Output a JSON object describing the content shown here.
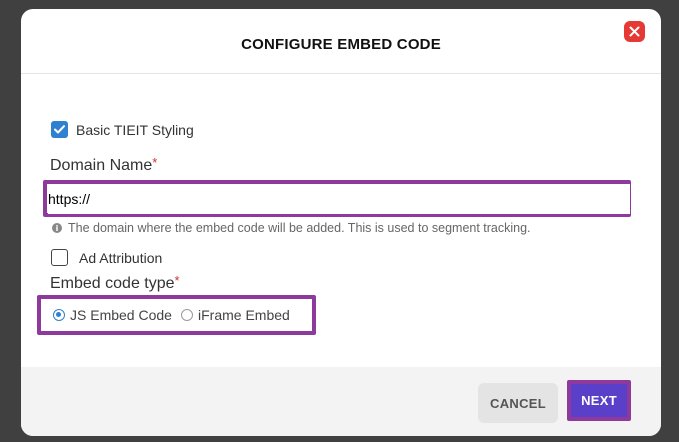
{
  "modal": {
    "title": "CONFIGURE EMBED CODE",
    "close_icon": "close-icon"
  },
  "form": {
    "basic_styling": {
      "label": "Basic TIEIT Styling",
      "checked": true
    },
    "domain": {
      "label": "Domain Name",
      "required_mark": "*",
      "value": "https://",
      "hint": "The domain where the embed code will be added. This is used to segment tracking."
    },
    "ad_attribution": {
      "label": "Ad Attribution",
      "checked": false
    },
    "embed_type": {
      "label": "Embed code type",
      "required_mark": "*",
      "options": [
        {
          "label": "JS Embed Code",
          "selected": true
        },
        {
          "label": "iFrame Embed",
          "selected": false
        }
      ]
    }
  },
  "footer": {
    "cancel_label": "CANCEL",
    "next_label": "NEXT"
  },
  "colors": {
    "accent": "#2f80d1",
    "primary_button": "#5a40c9",
    "highlight": "#8e3a9d",
    "close": "#e53935"
  }
}
